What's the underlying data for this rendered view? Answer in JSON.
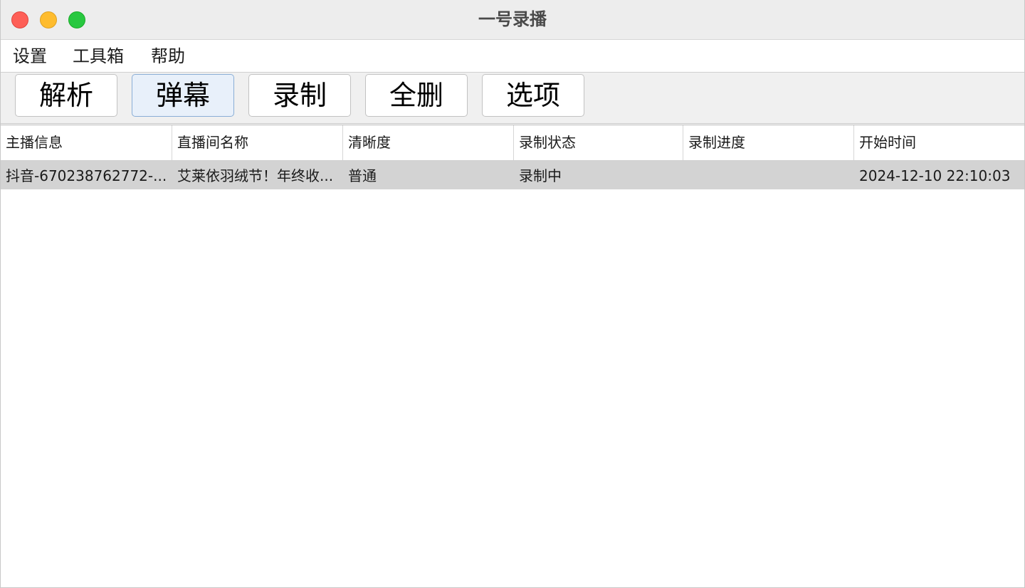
{
  "window": {
    "title": "一号录播"
  },
  "menu": {
    "items": [
      {
        "label": "设置"
      },
      {
        "label": "工具箱"
      },
      {
        "label": "帮助"
      }
    ]
  },
  "toolbar": {
    "buttons": [
      {
        "label": "解析"
      },
      {
        "label": "弹幕",
        "focused": true
      },
      {
        "label": "录制"
      },
      {
        "label": "全删"
      },
      {
        "label": "选项"
      }
    ]
  },
  "table": {
    "columns": [
      "主播信息",
      "直播间名称",
      "清晰度",
      "录制状态",
      "录制进度",
      "开始时间"
    ],
    "rows": [
      {
        "cells": [
          "抖音-670238762772-...",
          "艾莱依羽绒节！年终收...",
          "普通",
          "录制中",
          "",
          "2024-12-10 22:10:03"
        ],
        "selected": true
      }
    ]
  },
  "colors": {
    "titlebar": "#ededed",
    "selected_row": "#d3d3d3",
    "close": "#fe5f57",
    "minimize": "#febc2e",
    "maximize": "#28c840"
  }
}
